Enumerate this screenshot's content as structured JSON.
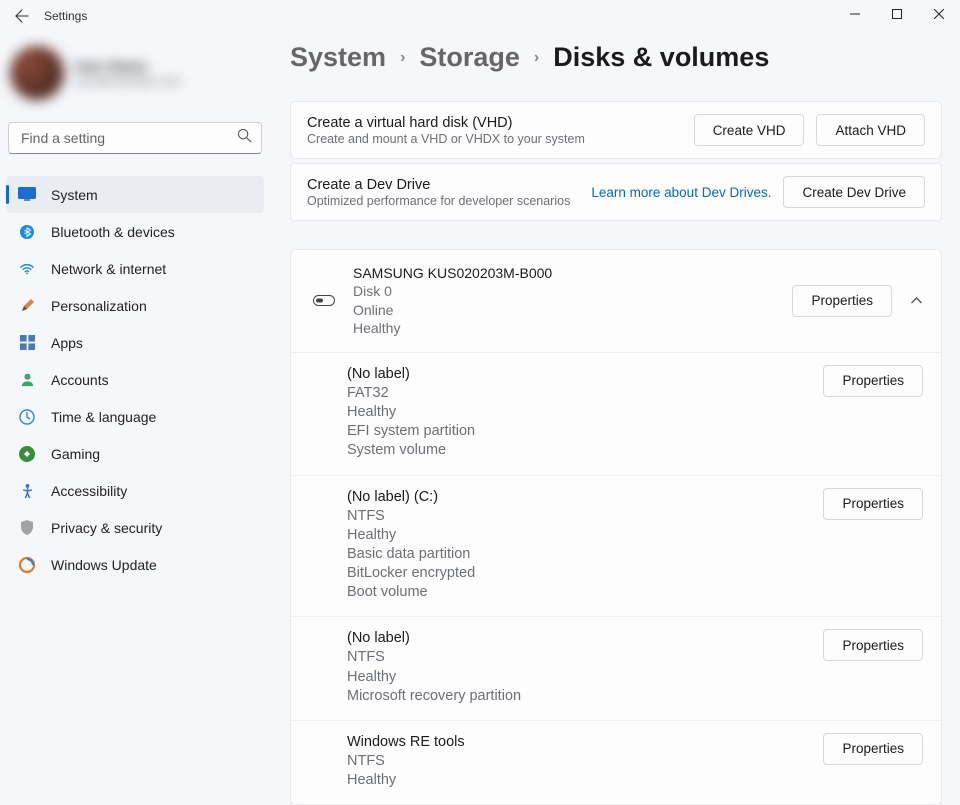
{
  "titlebar": {
    "app_name": "Settings"
  },
  "search": {
    "placeholder": "Find a setting"
  },
  "sidebar": {
    "items": [
      {
        "label": "System"
      },
      {
        "label": "Bluetooth & devices"
      },
      {
        "label": "Network & internet"
      },
      {
        "label": "Personalization"
      },
      {
        "label": "Apps"
      },
      {
        "label": "Accounts"
      },
      {
        "label": "Time & language"
      },
      {
        "label": "Gaming"
      },
      {
        "label": "Accessibility"
      },
      {
        "label": "Privacy & security"
      },
      {
        "label": "Windows Update"
      }
    ]
  },
  "breadcrumb": {
    "p0": "System",
    "p1": "Storage",
    "current": "Disks & volumes"
  },
  "vhd_card": {
    "title": "Create a virtual hard disk (VHD)",
    "sub": "Create and mount a VHD or VHDX to your system",
    "create": "Create VHD",
    "attach": "Attach VHD"
  },
  "devdrive_card": {
    "title": "Create a Dev Drive",
    "sub": "Optimized performance for developer scenarios",
    "link": "Learn more about Dev Drives.",
    "create": "Create Dev Drive"
  },
  "disk": {
    "name": "SAMSUNG KUS020203M-B000",
    "id": "Disk 0",
    "state": "Online",
    "health": "Healthy",
    "props": "Properties"
  },
  "volumes": [
    {
      "name": "(No label)",
      "fs": "FAT32",
      "health": "Healthy",
      "l1": "EFI system partition",
      "l2": "System volume",
      "props": "Properties"
    },
    {
      "name": "(No label) (C:)",
      "fs": "NTFS",
      "health": "Healthy",
      "l1": "Basic data partition",
      "l2": "BitLocker encrypted",
      "l3": "Boot volume",
      "props": "Properties"
    },
    {
      "name": "(No label)",
      "fs": "NTFS",
      "health": "Healthy",
      "l1": "Microsoft recovery partition",
      "props": "Properties"
    },
    {
      "name": "Windows RE tools",
      "fs": "NTFS",
      "health": "Healthy",
      "props": "Properties"
    }
  ]
}
